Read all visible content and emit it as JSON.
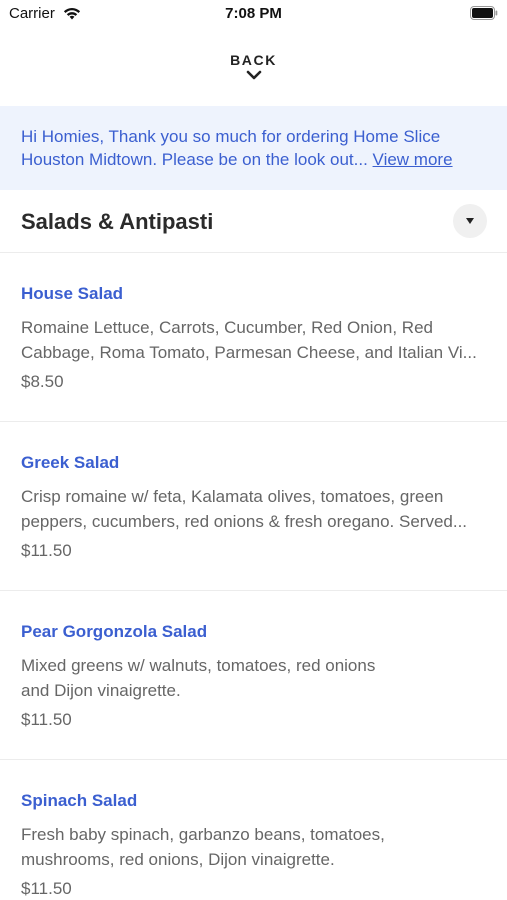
{
  "status_bar": {
    "carrier": "Carrier",
    "time": "7:08 PM"
  },
  "nav": {
    "back_label": "BACK"
  },
  "banner": {
    "message": "Hi Homies, Thank you so much for ordering Home Slice Houston Midtown. Please be on the look out... ",
    "link_label": "View more",
    "background": "#eef3fd",
    "text_color": "#3b5fd0"
  },
  "section": {
    "title": "Salads & Antipasti"
  },
  "items": [
    {
      "name": "House Salad",
      "description": "Romaine Lettuce, Carrots, Cucumber, Red Onion, Red\nCabbage, Roma Tomato, Parmesan Cheese, and Italian Vi...",
      "price": "$8.50"
    },
    {
      "name": "Greek Salad",
      "description": "Crisp romaine w/ feta, Kalamata olives, tomatoes, green\npeppers, cucumbers, red onions & fresh oregano. Served...",
      "price": "$11.50"
    },
    {
      "name": "Pear Gorgonzola Salad",
      "description": "Mixed greens w/ walnuts, tomatoes, red onions\nand Dijon vinaigrette.",
      "price": "$11.50"
    },
    {
      "name": "Spinach Salad",
      "description": "Fresh baby spinach, garbanzo beans, tomatoes,\nmushrooms, red onions, Dijon vinaigrette.",
      "price": "$11.50"
    }
  ],
  "colors": {
    "accent": "#3b5fd0",
    "muted_text": "#666666",
    "divider": "#ececec"
  },
  "icons": [
    "wifi-icon",
    "battery-icon",
    "chevron-down-icon",
    "caret-down-icon"
  ]
}
